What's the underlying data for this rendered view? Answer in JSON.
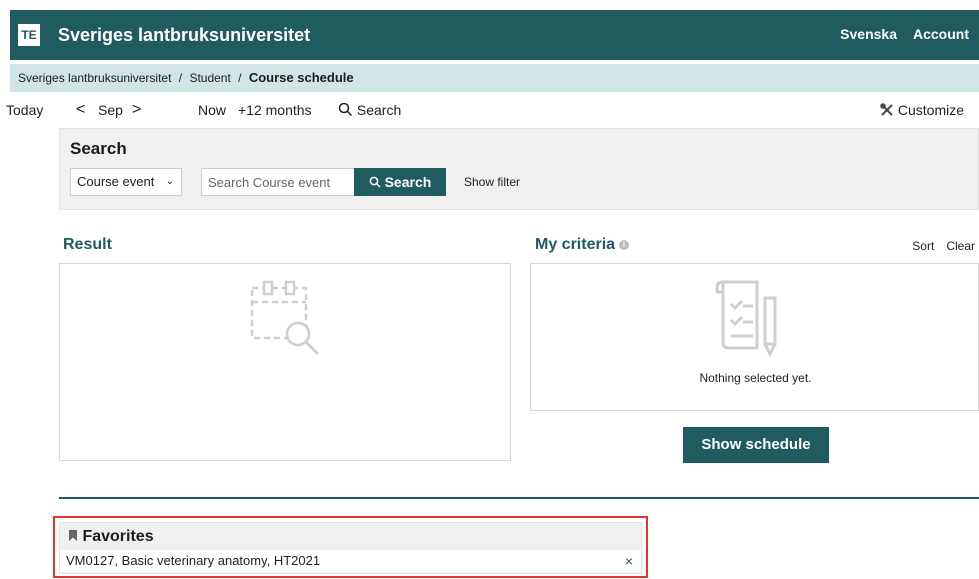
{
  "header": {
    "logo_text": "TE",
    "title": "Sveriges lantbruksuniversitet",
    "language_link": "Svenska",
    "account_link": "Account"
  },
  "breadcrumb": {
    "items": [
      "Sveriges lantbruksuniversitet",
      "Student"
    ],
    "separator": "/",
    "current": "Course schedule"
  },
  "toolbar": {
    "today": "Today",
    "prev": "<",
    "month": "Sep",
    "next": ">",
    "now": "Now",
    "range": "+12 months",
    "search": "Search",
    "customize": "Customize"
  },
  "search": {
    "title": "Search",
    "type_select": "Course event",
    "placeholder": "Search Course event",
    "button": "Search",
    "show_filter": "Show filter"
  },
  "result": {
    "title": "Result"
  },
  "criteria": {
    "title": "My criteria",
    "sort": "Sort",
    "clear": "Clear",
    "empty_text": "Nothing selected yet."
  },
  "show_schedule": "Show schedule",
  "favorites": {
    "title": "Favorites",
    "items": [
      {
        "label": "VM0127, Basic veterinary anatomy, HT2021",
        "remove": "×"
      }
    ]
  },
  "colors": {
    "brand": "#1f5b5f",
    "breadcrumb_bg": "#cfe5e6",
    "panel_bg": "#f0f0f0",
    "highlight": "#e33232"
  }
}
